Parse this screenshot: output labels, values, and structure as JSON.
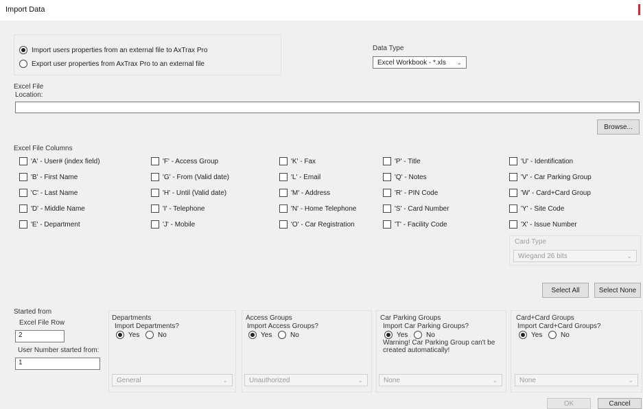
{
  "window": {
    "title": "Import Data",
    "accent_color": "#dd2233"
  },
  "mode": {
    "options": [
      {
        "label": "Import users properties from an external file to AxTrax Pro",
        "selected": true
      },
      {
        "label": "Export user properties from AxTrax Pro to an external file",
        "selected": false
      }
    ]
  },
  "data_type": {
    "label": "Data Type",
    "value": "Excel Workbook - *.xls"
  },
  "excel_file": {
    "group_label": "Excel File",
    "location_label": "Location:",
    "location_value": "",
    "browse_label": "Browse..."
  },
  "columns": {
    "group_label": "Excel File Columns",
    "col1": [
      {
        "label": "'A' - User# (index field)",
        "checked": false
      },
      {
        "label": "'B' - First Name",
        "checked": false
      },
      {
        "label": "'C' - Last Name",
        "checked": false
      },
      {
        "label": "'D' - Middle Name",
        "checked": false
      },
      {
        "label": "'E' - Department",
        "checked": false
      }
    ],
    "col2": [
      {
        "label": "'F' - Access Group",
        "checked": false
      },
      {
        "label": "'G' - From (Valid date)",
        "checked": false
      },
      {
        "label": "'H' - Until (Valid date)",
        "checked": false
      },
      {
        "label": "'I' - Telephone",
        "checked": false
      },
      {
        "label": "'J' - Mobile",
        "checked": false
      }
    ],
    "col3": [
      {
        "label": "'K' - Fax",
        "checked": false
      },
      {
        "label": "'L' - Email",
        "checked": false
      },
      {
        "label": "'M' - Address",
        "checked": false
      },
      {
        "label": "'N' - Home Telephone",
        "checked": false
      },
      {
        "label": "'O' - Car Registration",
        "checked": false
      }
    ],
    "col4": [
      {
        "label": "'P' - Title",
        "checked": false
      },
      {
        "label": "'Q' - Notes",
        "checked": false
      },
      {
        "label": "'R' - PIN Code",
        "checked": false
      },
      {
        "label": "'S' - Card Number",
        "checked": false
      },
      {
        "label": "'T' - Facility Code",
        "checked": false
      }
    ],
    "col5": [
      {
        "label": "'U' - Identification",
        "checked": false
      },
      {
        "label": "'V' - Car Parking Group",
        "checked": false
      },
      {
        "label": "'W' - Card+Card Group",
        "checked": false
      },
      {
        "label": "'Y' - Site Code",
        "checked": false
      },
      {
        "label": "'X' - Issue Number",
        "checked": false
      }
    ],
    "card_type": {
      "label": "Card Type",
      "value": "Wiegand 26 bits"
    },
    "select_all_label": "Select All",
    "select_none_label": "Select None"
  },
  "started_from": {
    "group_label": "Started from",
    "row_label": "Excel File Row",
    "row_value": "2",
    "user_number_label": "User Number started from:",
    "user_number_value": "1"
  },
  "departments": {
    "title": "Departments",
    "question": "Import Departments?",
    "yes": "Yes",
    "no": "No",
    "selected": "Yes",
    "default_value": "General"
  },
  "access_groups": {
    "title": "Access Groups",
    "question": "Import Access Groups?",
    "yes": "Yes",
    "no": "No",
    "selected": "Yes",
    "default_value": "Unauthorized"
  },
  "car_parking": {
    "title": "Car Parking Groups",
    "question": "Import Car Parking Groups?",
    "yes": "Yes",
    "no": "No",
    "selected": "Yes",
    "warning": "Warning! Car Parking Group can't be created automatically!",
    "default_value": "None"
  },
  "card_groups": {
    "title": "Card+Card Groups",
    "question": "Import Card+Card Groups?",
    "yes": "Yes",
    "no": "No",
    "selected": "Yes",
    "default_value": "None"
  },
  "footer": {
    "ok_label": "OK",
    "cancel_label": "Cancel"
  }
}
